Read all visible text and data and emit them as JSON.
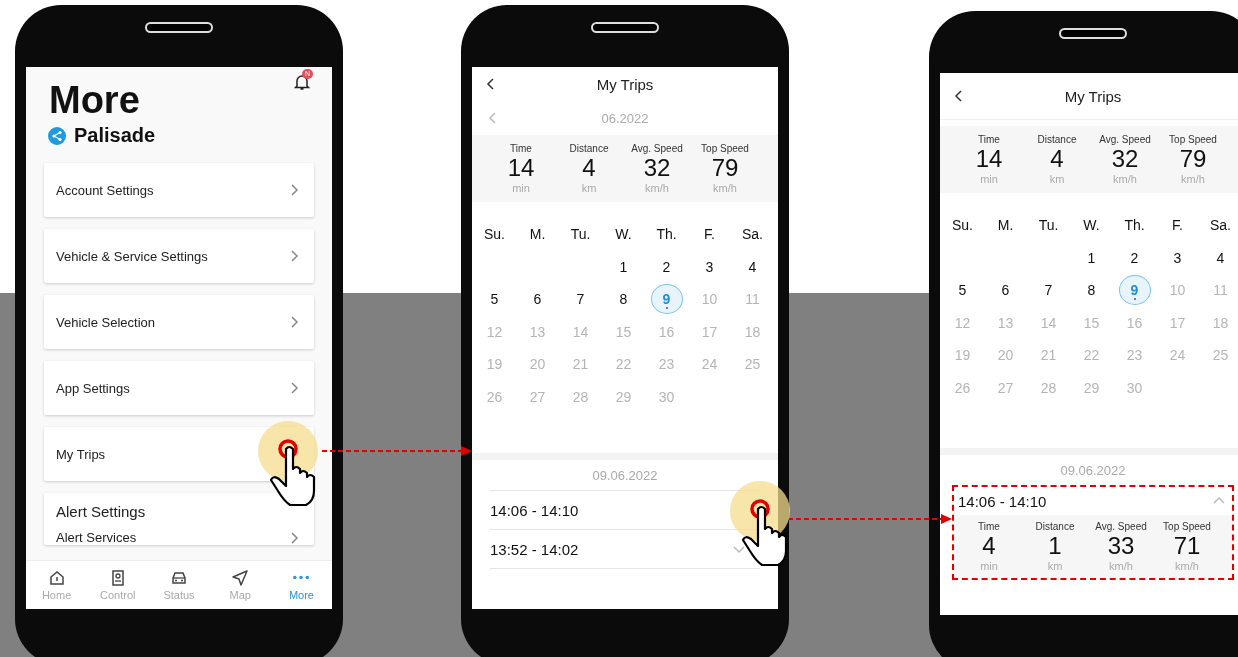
{
  "screens": [
    {
      "kind": "more",
      "title": "More",
      "vehicle": "Palisade",
      "notification_badge": "N",
      "menu_items": [
        {
          "label": "Account Settings",
          "tapped": false
        },
        {
          "label": "Vehicle & Service Settings",
          "tapped": false
        },
        {
          "label": "Vehicle Selection",
          "tapped": false
        },
        {
          "label": "App Settings",
          "tapped": false
        },
        {
          "label": "My Trips",
          "tapped": true
        }
      ],
      "section": {
        "title": "Alert Settings",
        "items": [
          "Alert Services"
        ]
      },
      "nav": [
        {
          "label": "Home",
          "selected": false
        },
        {
          "label": "Control",
          "selected": false
        },
        {
          "label": "Status",
          "selected": false
        },
        {
          "label": "Map",
          "selected": false
        },
        {
          "label": "More",
          "selected": true
        }
      ]
    },
    {
      "kind": "trips",
      "title": "My Trips",
      "month": "06.2022",
      "summary": [
        {
          "label": "Time",
          "value": "14",
          "unit": "min"
        },
        {
          "label": "Distance",
          "value": "4",
          "unit": "km"
        },
        {
          "label": "Avg. Speed",
          "value": "32",
          "unit": "km/h"
        },
        {
          "label": "Top Speed",
          "value": "79",
          "unit": "km/h"
        }
      ],
      "weekdays": [
        "Su.",
        "M.",
        "Tu.",
        "W.",
        "Th.",
        "F.",
        "Sa."
      ],
      "weeks": [
        {
          "align_end": true,
          "days": [
            {
              "label": "1",
              "disabled": false,
              "selected": false
            },
            {
              "label": "2",
              "disabled": false,
              "selected": false
            },
            {
              "label": "3",
              "disabled": false,
              "selected": false
            },
            {
              "label": "4",
              "disabled": false,
              "selected": false
            }
          ]
        },
        {
          "align_end": false,
          "days": [
            {
              "label": "5",
              "disabled": false,
              "selected": false
            },
            {
              "label": "6",
              "disabled": false,
              "selected": false
            },
            {
              "label": "7",
              "disabled": false,
              "selected": false
            },
            {
              "label": "8",
              "disabled": false,
              "selected": false
            },
            {
              "label": "9",
              "disabled": false,
              "selected": true
            },
            {
              "label": "10",
              "disabled": true,
              "selected": false
            },
            {
              "label": "11",
              "disabled": true,
              "selected": false
            }
          ]
        },
        {
          "align_end": false,
          "days": [
            {
              "label": "12",
              "disabled": true,
              "selected": false
            },
            {
              "label": "13",
              "disabled": true,
              "selected": false
            },
            {
              "label": "14",
              "disabled": true,
              "selected": false
            },
            {
              "label": "15",
              "disabled": true,
              "selected": false
            },
            {
              "label": "16",
              "disabled": true,
              "selected": false
            },
            {
              "label": "17",
              "disabled": true,
              "selected": false
            },
            {
              "label": "18",
              "disabled": true,
              "selected": false
            }
          ]
        },
        {
          "align_end": false,
          "days": [
            {
              "label": "19",
              "disabled": true,
              "selected": false
            },
            {
              "label": "20",
              "disabled": true,
              "selected": false
            },
            {
              "label": "21",
              "disabled": true,
              "selected": false
            },
            {
              "label": "22",
              "disabled": true,
              "selected": false
            },
            {
              "label": "23",
              "disabled": true,
              "selected": false
            },
            {
              "label": "24",
              "disabled": true,
              "selected": false
            },
            {
              "label": "25",
              "disabled": true,
              "selected": false
            }
          ]
        },
        {
          "align_end": false,
          "days": [
            {
              "label": "26",
              "disabled": true,
              "selected": false
            },
            {
              "label": "27",
              "disabled": true,
              "selected": false
            },
            {
              "label": "28",
              "disabled": true,
              "selected": false
            },
            {
              "label": "29",
              "disabled": true,
              "selected": false
            },
            {
              "label": "30",
              "disabled": true,
              "selected": false
            }
          ]
        }
      ],
      "date_heading": "09.06.2022",
      "trips": [
        {
          "time": "14:06 - 14:10",
          "expanded": false,
          "tapped": true,
          "highlighted": false
        },
        {
          "time": "13:52 - 14:02",
          "expanded": false,
          "tapped": false,
          "highlighted": false
        }
      ]
    },
    {
      "kind": "trips",
      "title": "My Trips",
      "summary": [
        {
          "label": "Time",
          "value": "14",
          "unit": "min"
        },
        {
          "label": "Distance",
          "value": "4",
          "unit": "km"
        },
        {
          "label": "Avg. Speed",
          "value": "32",
          "unit": "km/h"
        },
        {
          "label": "Top Speed",
          "value": "79",
          "unit": "km/h"
        }
      ],
      "weekdays": [
        "Su.",
        "M.",
        "Tu.",
        "W.",
        "Th.",
        "F.",
        "Sa."
      ],
      "weeks": [
        {
          "align_end": true,
          "days": [
            {
              "label": "1",
              "disabled": false,
              "selected": false
            },
            {
              "label": "2",
              "disabled": false,
              "selected": false
            },
            {
              "label": "3",
              "disabled": false,
              "selected": false
            },
            {
              "label": "4",
              "disabled": false,
              "selected": false
            }
          ]
        },
        {
          "align_end": false,
          "days": [
            {
              "label": "5",
              "disabled": false,
              "selected": false
            },
            {
              "label": "6",
              "disabled": false,
              "selected": false
            },
            {
              "label": "7",
              "disabled": false,
              "selected": false
            },
            {
              "label": "8",
              "disabled": false,
              "selected": false
            },
            {
              "label": "9",
              "disabled": false,
              "selected": true
            },
            {
              "label": "10",
              "disabled": true,
              "selected": false
            },
            {
              "label": "11",
              "disabled": true,
              "selected": false
            }
          ]
        },
        {
          "align_end": false,
          "days": [
            {
              "label": "12",
              "disabled": true,
              "selected": false
            },
            {
              "label": "13",
              "disabled": true,
              "selected": false
            },
            {
              "label": "14",
              "disabled": true,
              "selected": false
            },
            {
              "label": "15",
              "disabled": true,
              "selected": false
            },
            {
              "label": "16",
              "disabled": true,
              "selected": false
            },
            {
              "label": "17",
              "disabled": true,
              "selected": false
            },
            {
              "label": "18",
              "disabled": true,
              "selected": false
            }
          ]
        },
        {
          "align_end": false,
          "days": [
            {
              "label": "19",
              "disabled": true,
              "selected": false
            },
            {
              "label": "20",
              "disabled": true,
              "selected": false
            },
            {
              "label": "21",
              "disabled": true,
              "selected": false
            },
            {
              "label": "22",
              "disabled": true,
              "selected": false
            },
            {
              "label": "23",
              "disabled": true,
              "selected": false
            },
            {
              "label": "24",
              "disabled": true,
              "selected": false
            },
            {
              "label": "25",
              "disabled": true,
              "selected": false
            }
          ]
        },
        {
          "align_end": false,
          "days": [
            {
              "label": "26",
              "disabled": true,
              "selected": false
            },
            {
              "label": "27",
              "disabled": true,
              "selected": false
            },
            {
              "label": "28",
              "disabled": true,
              "selected": false
            },
            {
              "label": "29",
              "disabled": true,
              "selected": false
            },
            {
              "label": "30",
              "disabled": true,
              "selected": false
            }
          ]
        }
      ],
      "date_heading": "09.06.2022",
      "trips": [
        {
          "time": "14:06 - 14:10",
          "expanded": true,
          "tapped": false,
          "highlighted": true,
          "summary": [
            {
              "label": "Time",
              "value": "4",
              "unit": "min"
            },
            {
              "label": "Distance",
              "value": "1",
              "unit": "km"
            },
            {
              "label": "Avg. Speed",
              "value": "33",
              "unit": "km/h"
            },
            {
              "label": "Top Speed",
              "value": "71",
              "unit": "km/h"
            }
          ]
        }
      ]
    }
  ]
}
